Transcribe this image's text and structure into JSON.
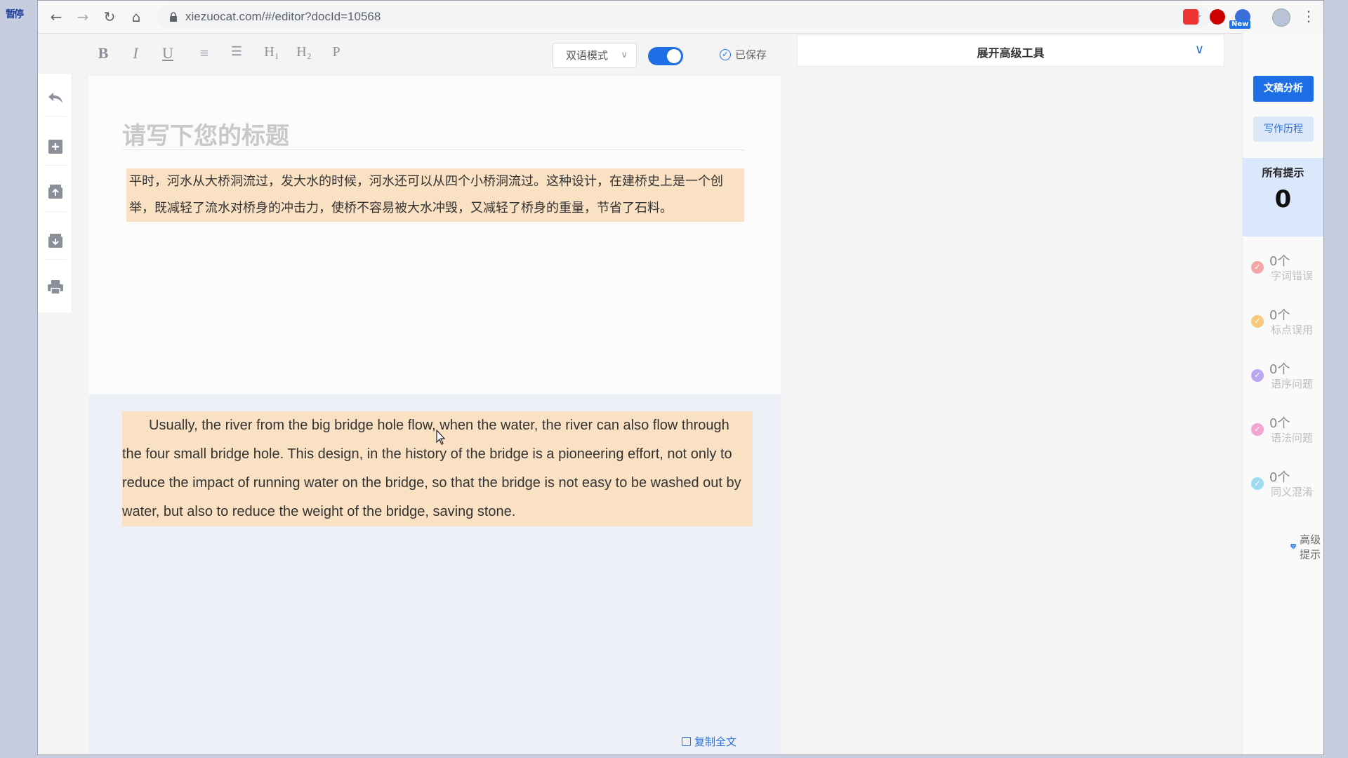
{
  "desktop": {
    "label": "暂停"
  },
  "browser": {
    "url": "xiezuocat.com/#/editor?docId=10568",
    "ext_new_badge": "New"
  },
  "toolbar": {
    "format_buttons": [
      {
        "label": "B",
        "icon": "bold-icon"
      },
      {
        "label": "I",
        "icon": "italic-icon"
      },
      {
        "label": "U",
        "icon": "underline-icon"
      },
      {
        "label": "≡",
        "icon": "ordered-list-icon"
      },
      {
        "label": "☰",
        "icon": "bullet-list-icon"
      },
      {
        "label": "H₁",
        "icon": "heading1-icon"
      },
      {
        "label": "H₂",
        "icon": "heading2-icon"
      },
      {
        "label": "P",
        "icon": "paragraph-icon"
      }
    ],
    "mode_select": "双语模式",
    "toggle_on": true,
    "saved_status": "已保存"
  },
  "editor": {
    "title_placeholder": "请写下您的标题",
    "chinese_paragraph": "平时，河水从大桥洞流过，发大水的时候，河水还可以从四个小桥洞流过。这种设计，在建桥史上是一个创举，既减轻了流水对桥身的冲击力，使桥不容易被大水冲毁，又减轻了桥身的重量，节省了石料。",
    "english_paragraph": "Usually, the river from the big bridge hole flow, when the water, the river can also flow through the four small bridge hole. This design, in the history of the bridge is a pioneering effort, not only to reduce the impact of running water on the bridge, so that the bridge is not easy to be washed out by water, but also to reduce the weight of the bridge, saving stone.",
    "copy_all": "复制全文"
  },
  "advanced_tools": {
    "title": "展开高级工具"
  },
  "right_panel": {
    "analysis_button": "文稿分析",
    "history_button": "写作历程",
    "hints_title": "所有提示",
    "hints_count": "0",
    "categories": [
      {
        "count": "0个",
        "label": "字词错误",
        "color": "#f4a6a6"
      },
      {
        "count": "0个",
        "label": "标点误用",
        "color": "#f7c97a"
      },
      {
        "count": "0个",
        "label": "语序问题",
        "color": "#b9a8ee"
      },
      {
        "count": "0个",
        "label": "语法问题",
        "color": "#f2a6cf"
      },
      {
        "count": "0个",
        "label": "同义混淆",
        "color": "#9fdbef"
      }
    ],
    "advanced_hint": "高级提示"
  },
  "colors": {
    "accent": "#1e6fe6",
    "highlight": "#fbe1c3",
    "bilingual_bg": "#edf1f7"
  }
}
